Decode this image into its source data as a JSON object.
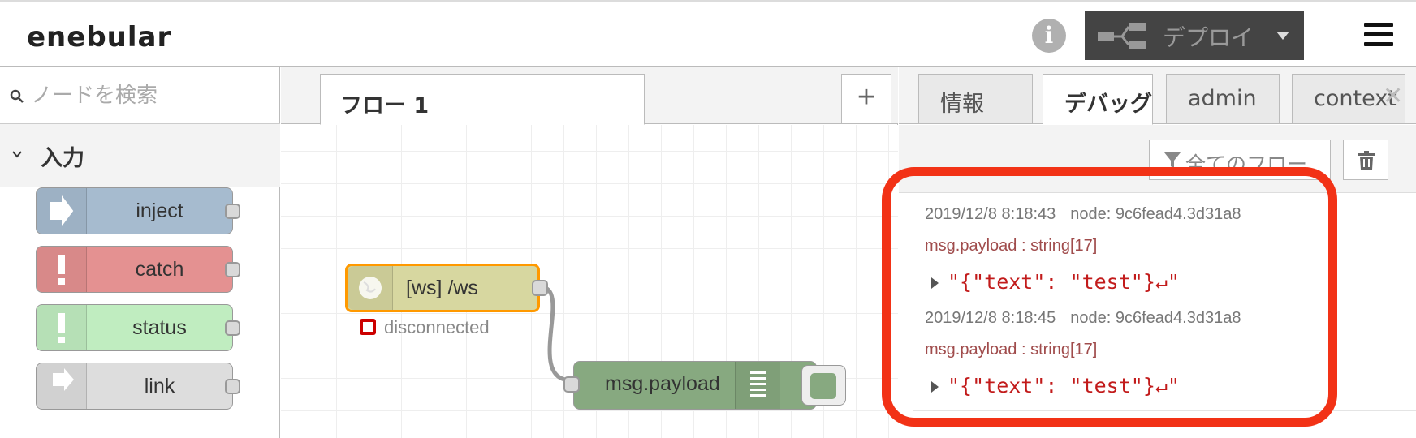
{
  "header": {
    "logo": "enebular",
    "info_icon": "i",
    "deploy_label": "デプロイ",
    "icons": [
      "deploy-icon",
      "chevron-down-icon",
      "hamburger-menu-icon",
      "info-icon"
    ]
  },
  "palette": {
    "search_placeholder": "ノードを検索",
    "category": "入力",
    "nodes": [
      {
        "label": "inject",
        "color": "#a6bbcf",
        "icon": "inject-arrow-icon"
      },
      {
        "label": "catch",
        "color": "#e49191",
        "icon": "exclamation-icon"
      },
      {
        "label": "status",
        "color": "#c0edc0",
        "icon": "exclamation-icon"
      },
      {
        "label": "link",
        "color": "#dddddd",
        "icon": "link-icon"
      }
    ]
  },
  "workspace": {
    "tab": "フロー 1",
    "add_label": "+",
    "nodes": [
      {
        "label": "[ws] /ws",
        "color": "#d7d7a0",
        "status": "disconnected"
      },
      {
        "label": "msg.payload",
        "color": "#87a980"
      }
    ]
  },
  "sidebar": {
    "tabs": [
      "情報",
      "デバッグ",
      "admin",
      "context"
    ],
    "active_tab": "デバッグ",
    "close": "✕",
    "filter_label": "全てのフロー",
    "messages": [
      {
        "time": "2019/12/8 8:18:43",
        "node": "node: 9c6fead4.3d31a8",
        "topic": "msg.payload : string[17]",
        "value": "\"{\"text\": \"test\"}↵\""
      },
      {
        "time": "2019/12/8 8:18:45",
        "node": "node: 9c6fead4.3d31a8",
        "topic": "msg.payload : string[17]",
        "value": "\"{\"text\": \"test\"}↵\""
      }
    ]
  },
  "colors": {
    "highlight": "#f23216",
    "deploy_bg": "#444444",
    "ws_node_border": "#ff9900"
  }
}
